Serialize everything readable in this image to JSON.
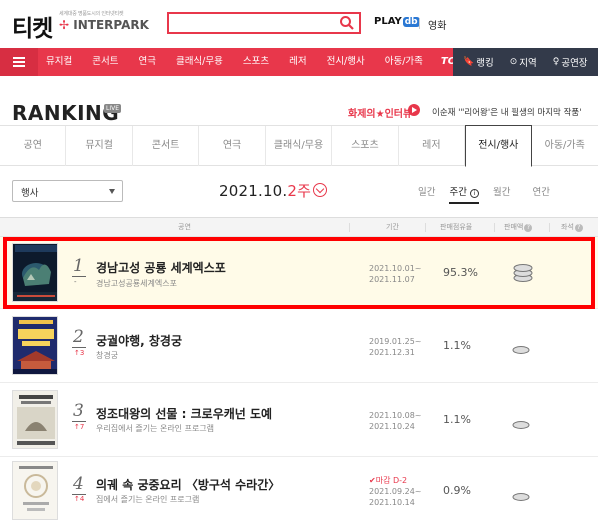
{
  "header": {
    "logo_main": "티켓",
    "logo_sub": "세계대중 명품도시의 인터넷티켓",
    "logo_brand_first": "✢",
    "logo_brand": "INTERPARK",
    "playdb_label": "PLAY",
    "playdb_badge": "db",
    "movie_label": "영화",
    "search": {
      "value": "",
      "placeholder": ""
    }
  },
  "nav": {
    "items": [
      "뮤지컬",
      "콘서트",
      "연극",
      "클래식/무용",
      "스포츠",
      "레저",
      "전시/행사",
      "아동/가족",
      "TOPING"
    ],
    "right_items": [
      {
        "icon": "🔖",
        "label": "랭킹"
      },
      {
        "icon": "⊙",
        "label": "지역"
      },
      {
        "icon": "♀",
        "label": "공연장"
      }
    ]
  },
  "ranking": {
    "title": "RANKING",
    "live": "LIVE",
    "banner_label": "화제의★인터뷰",
    "banner_text": "이순재 '\"리어왕'은 내 필생의 마지막 작품'"
  },
  "category_tabs": [
    "공연",
    "뮤지컬",
    "콘서트",
    "연극",
    "클래식/무용",
    "스포츠",
    "레저",
    "전시/행사",
    "아동/가족"
  ],
  "active_category": "전시/행사",
  "filter": {
    "select_value": "행사",
    "date_prefix": "2021.10.",
    "date_week": "2주",
    "periods": [
      "일간",
      "주간",
      "월간",
      "연간"
    ],
    "active_period": "주간"
  },
  "table_header": {
    "show": "공연",
    "period": "기간",
    "share": "판매점유율",
    "sales": "판매액",
    "seats": "좌석"
  },
  "rows": [
    {
      "rank": "1",
      "change": "-",
      "title": "경남고성 공룡 세계엑스포",
      "subtitle": "경남고성공룡세계엑스포",
      "closing": "",
      "period_start": "2021.10.01~",
      "period_end": "2021.11.07",
      "share": "95.3%",
      "sales_level": 3,
      "highlight": true
    },
    {
      "rank": "2",
      "change": "↑3",
      "title": "궁궐야행, 창경궁",
      "subtitle": "창경궁",
      "closing": "",
      "period_start": "2019.01.25~",
      "period_end": "2021.12.31",
      "share": "1.1%",
      "sales_level": 1,
      "highlight": false
    },
    {
      "rank": "3",
      "change": "↑7",
      "title": "정조대왕의 선물 : 크로우캐넌 도예",
      "subtitle": "우리집에서 즐기는 온라인 프로그램",
      "closing": "",
      "period_start": "2021.10.08~",
      "period_end": "2021.10.24",
      "share": "1.1%",
      "sales_level": 1,
      "highlight": false
    },
    {
      "rank": "4",
      "change": "↑4",
      "title": "의궤 속 궁중요리 〈방구석 수라간〉",
      "subtitle": "집에서 즐기는 온라인 프로그램",
      "closing": "✔마감 D-2",
      "period_start": "2021.09.24~",
      "period_end": "2021.10.14",
      "share": "0.9%",
      "sales_level": 1,
      "highlight": false
    }
  ],
  "colors": {
    "brand_red": "#e8374b",
    "nav_dark": "#333a4a",
    "highlight_bg": "#fffbe8"
  }
}
